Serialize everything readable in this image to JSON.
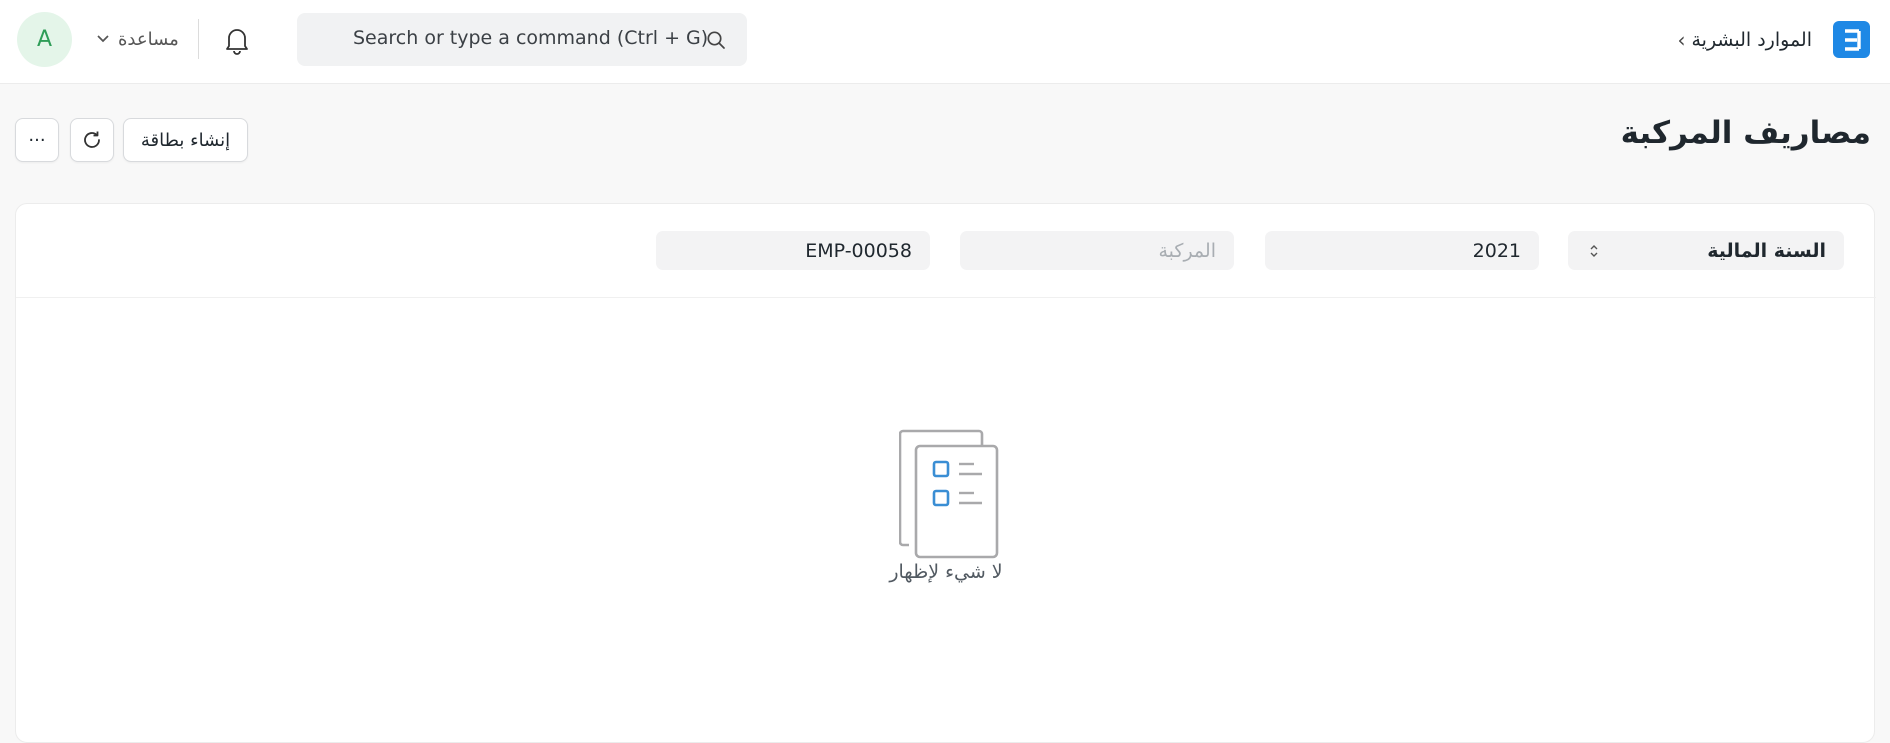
{
  "navbar": {
    "logo_letter": "E",
    "breadcrumb": {
      "module": "الموارد البشرية",
      "separator": "›"
    },
    "search": {
      "placeholder": "Search or type a command (Ctrl + G)",
      "icon": "search-icon"
    },
    "notifications_icon": "bell-icon",
    "help_label": "مساعدة",
    "avatar_initial": "A"
  },
  "page": {
    "title": "مصاريف المركبة",
    "actions": {
      "create_card_label": "إنشاء بطاقة",
      "refresh_icon": "refresh-icon",
      "more_label": "···"
    }
  },
  "filters": {
    "fiscal_year_label": "السنة المالية",
    "year_value": "2021",
    "vehicle_placeholder": "المركبة",
    "employee_value": "EMP-00058"
  },
  "empty_state": {
    "icon": "empty-list-icon",
    "message": "لا شيء لإظهار"
  },
  "colors": {
    "brand": "#1e88e5",
    "avatar_bg": "#e4f5e9",
    "avatar_text": "#2f9d58",
    "empty_icon_accent": "#3a8ed4"
  }
}
